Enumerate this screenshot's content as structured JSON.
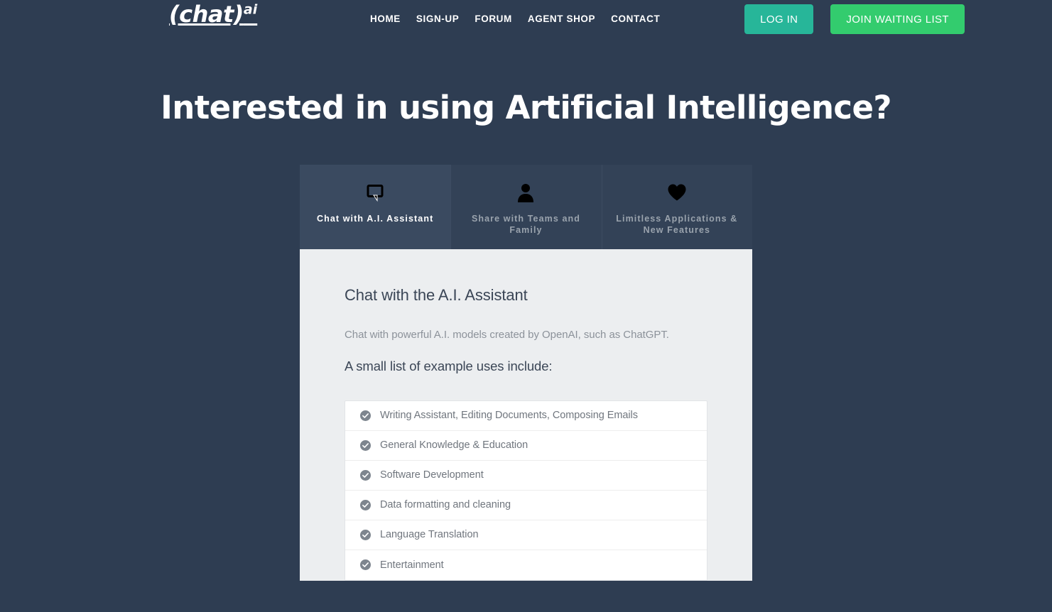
{
  "theme": {
    "page_bg": "#2e3d52",
    "card_bg": "#eceef0",
    "tab_bg": "#334257",
    "tab_active_bg": "#3a4a60",
    "login_green": "#27b699",
    "join_green": "#33cc6e",
    "heading_color": "#3b4656",
    "muted_text": "#8c929a"
  },
  "header": {
    "logo": {
      "main": "(chat)",
      "sup": "ai",
      "icon": "brand-logo"
    },
    "nav": [
      {
        "label": "HOME"
      },
      {
        "label": "SIGN-UP"
      },
      {
        "label": "FORUM"
      },
      {
        "label": "AGENT SHOP"
      },
      {
        "label": "CONTACT"
      }
    ],
    "login_label": "LOG IN",
    "join_label": "JOIN WAITING LIST"
  },
  "hero": {
    "title": "Interested in using Artificial Intelligence?"
  },
  "card": {
    "tabs": [
      {
        "label": "Chat with A.I. Assistant",
        "icon": "speech-bubble-icon",
        "active": true
      },
      {
        "label": "Share with Teams and Family",
        "icon": "person-icon",
        "active": false
      },
      {
        "label": "Limitless Applications & New Features",
        "icon": "heart-icon",
        "active": false
      }
    ],
    "panel": {
      "title": "Chat with the A.I. Assistant",
      "description": "Chat with powerful A.I. models created by OpenAI, such as ChatGPT.",
      "subtitle": "A small list of example uses include:",
      "features": [
        {
          "label": "Writing Assistant, Editing Documents, Composing Emails"
        },
        {
          "label": "General Knowledge & Education"
        },
        {
          "label": "Software Development"
        },
        {
          "label": "Data formatting and cleaning"
        },
        {
          "label": "Language Translation"
        },
        {
          "label": "Entertainment"
        }
      ]
    }
  }
}
